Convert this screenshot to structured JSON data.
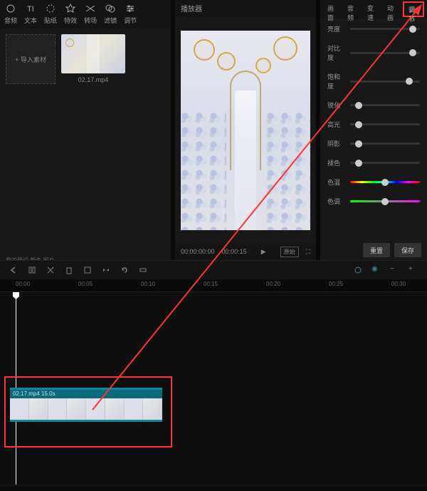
{
  "toolbar": [
    {
      "icon": "media",
      "label": "音频"
    },
    {
      "icon": "text",
      "label": "文本"
    },
    {
      "icon": "sticker",
      "label": "贴纸"
    },
    {
      "icon": "effect",
      "label": "特效"
    },
    {
      "icon": "transition",
      "label": "转场"
    },
    {
      "icon": "filter",
      "label": "滤镜"
    },
    {
      "icon": "adjust",
      "label": "调节"
    }
  ],
  "import": {
    "label": "+ 导入素材",
    "sub": "我的预设   颜色   图片"
  },
  "media": {
    "thumb_label": "02.17.mp4"
  },
  "player": {
    "title": "播放器",
    "time_current": "00:00:00:00",
    "time_total": "00:00:15",
    "ratio": "原始"
  },
  "right_tabs": [
    {
      "label": "画面",
      "active": false
    },
    {
      "label": "音频",
      "active": false
    },
    {
      "label": "变速",
      "active": false
    },
    {
      "label": "动画",
      "active": false
    },
    {
      "label": "调节",
      "active": true
    }
  ],
  "sliders": [
    {
      "label": "亮度",
      "value": 90,
      "type": "plain"
    },
    {
      "label": "对比度",
      "value": 90,
      "type": "plain"
    },
    {
      "label": "饱和度",
      "value": 85,
      "type": "plain"
    },
    {
      "label": "锐化",
      "value": 12,
      "type": "plain"
    },
    {
      "label": "高光",
      "value": 12,
      "type": "plain"
    },
    {
      "label": "阴影",
      "value": 12,
      "type": "plain"
    },
    {
      "label": "褪色",
      "value": 12,
      "type": "plain"
    },
    {
      "label": "色温",
      "value": 50,
      "type": "hue"
    },
    {
      "label": "色调",
      "value": 50,
      "type": "tint"
    }
  ],
  "buttons": {
    "reset": "重置",
    "apply": "保存"
  },
  "timeline": {
    "ruler": [
      {
        "t": "00:00",
        "pos": 22
      },
      {
        "t": "00:05",
        "pos": 110
      },
      {
        "t": "00:10",
        "pos": 198
      },
      {
        "t": "00:15",
        "pos": 286
      },
      {
        "t": "00:20",
        "pos": 374
      },
      {
        "t": "00:25",
        "pos": 462
      },
      {
        "t": "00:30",
        "pos": 550
      }
    ],
    "clip_label": "02.17.mp4   15.0s"
  }
}
